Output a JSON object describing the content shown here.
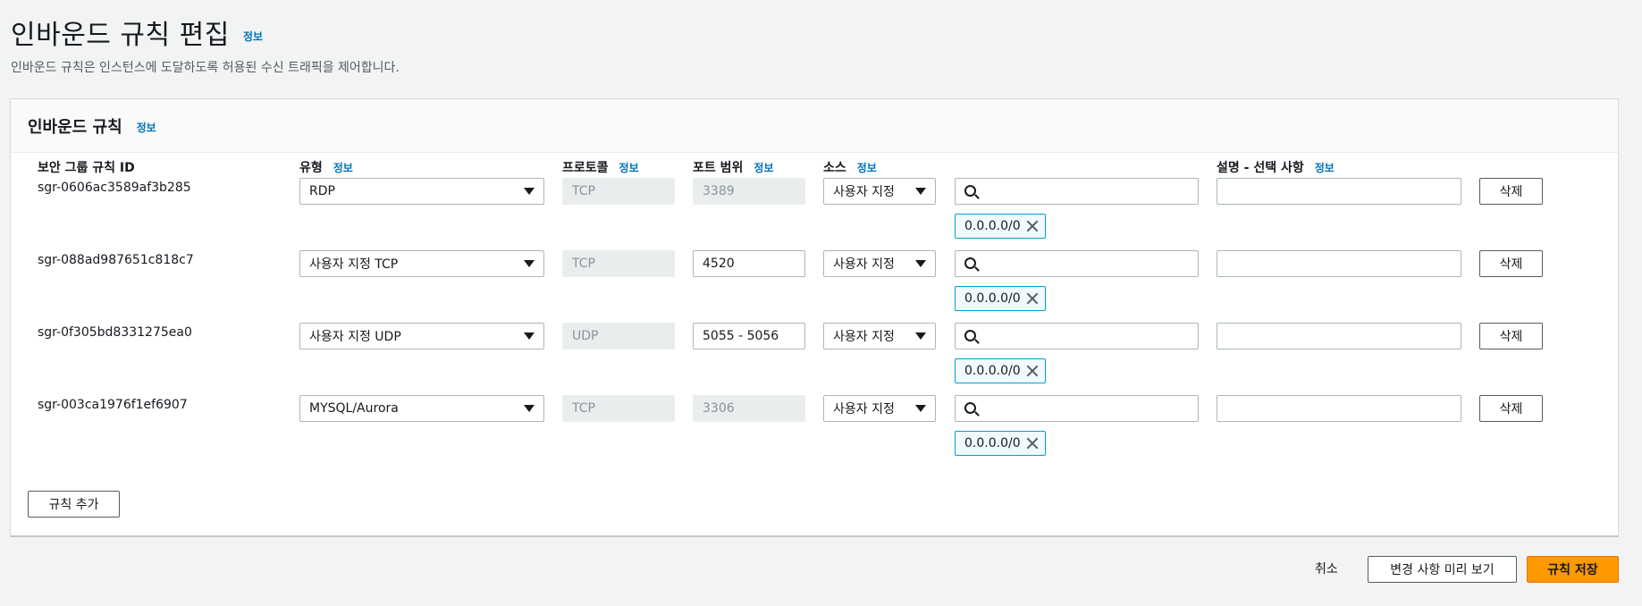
{
  "page": {
    "title": "인바운드 규칙 편집",
    "title_info": "정보",
    "description": "인바운드 규칙은 인스턴스에 도달하도록 허용된 수신 트래픽을 제어합니다."
  },
  "panel": {
    "title": "인바운드 규칙",
    "title_info": "정보",
    "columns": {
      "rule_id": "보안 그룹 규칙 ID",
      "type": "유형",
      "protocol": "프로토콜",
      "port_range": "포트 범위",
      "source": "소스",
      "description": "설명 - 선택 사항",
      "info": "정보"
    },
    "rules": [
      {
        "id": "sgr-0606ac3589af3b285",
        "type": "RDP",
        "protocol": "TCP",
        "port": "3389",
        "port_disabled": true,
        "source": "사용자 지정",
        "search_value": "",
        "cidr": "0.0.0.0/0",
        "desc_value": "",
        "delete": "삭제"
      },
      {
        "id": "sgr-088ad987651c818c7",
        "type": "사용자 지정 TCP",
        "protocol": "TCP",
        "port": "4520",
        "port_disabled": false,
        "source": "사용자 지정",
        "search_value": "",
        "cidr": "0.0.0.0/0",
        "desc_value": "",
        "delete": "삭제"
      },
      {
        "id": "sgr-0f305bd8331275ea0",
        "type": "사용자 지정 UDP",
        "protocol": "UDP",
        "port": "5055 - 5056",
        "port_disabled": false,
        "source": "사용자 지정",
        "search_value": "",
        "cidr": "0.0.0.0/0",
        "desc_value": "",
        "delete": "삭제"
      },
      {
        "id": "sgr-003ca1976f1ef6907",
        "type": "MYSQL/Aurora",
        "protocol": "TCP",
        "port": "3306",
        "port_disabled": true,
        "source": "사용자 지정",
        "search_value": "",
        "cidr": "0.0.0.0/0",
        "desc_value": "",
        "delete": "삭제"
      }
    ],
    "add_rule": "규칙 추가"
  },
  "footer": {
    "cancel": "취소",
    "preview": "변경 사항 미리 보기",
    "save": "규칙 저장"
  },
  "colors": {
    "primary": "#ff9900",
    "link": "#0073bb",
    "token_border": "#00a1c9"
  }
}
